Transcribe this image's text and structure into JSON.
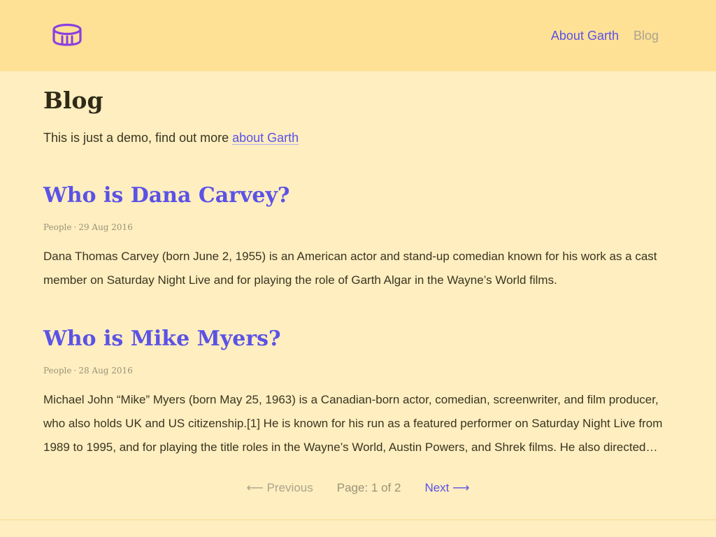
{
  "header": {
    "logo_icon": "drum-icon",
    "nav": [
      {
        "label": "About Garth",
        "active": false
      },
      {
        "label": "Blog",
        "active": true
      }
    ]
  },
  "page": {
    "title": "Blog",
    "intro_text": "This is just a demo, find out more ",
    "intro_link": "about Garth"
  },
  "posts": [
    {
      "title": "Who is Dana Carvey?",
      "category": "People",
      "separator": "·",
      "date": "29 Aug 2016",
      "excerpt": "Dana Thomas Carvey (born June 2, 1955) is an American actor and stand-up comedian known for his work as a cast member on Saturday Night Live and for playing the role of Garth Algar in the Wayne’s World films."
    },
    {
      "title": "Who is Mike Myers?",
      "category": "People",
      "separator": "·",
      "date": "28 Aug 2016",
      "excerpt": "Michael John “Mike” Myers (born May 25, 1963) is a Canadian-born actor, comedian, screenwriter, and film producer, who also holds UK and US citizenship.[1] He is known for his run as a featured performer on Saturday Night Live from 1989 to 1995, and for playing the title roles in the Wayne’s World, Austin Powers, and Shrek films. He also directed…"
    }
  ],
  "pagination": {
    "previous_label": "⟵ Previous",
    "page_info": "Page: 1 of 2",
    "next_label": "Next ⟶"
  },
  "colors": {
    "header_bg": "#FFE196",
    "page_bg": "#FEEEC0",
    "accent": "#5B52E6",
    "muted": "#ABA48C",
    "logo": "#8B3FE0"
  }
}
